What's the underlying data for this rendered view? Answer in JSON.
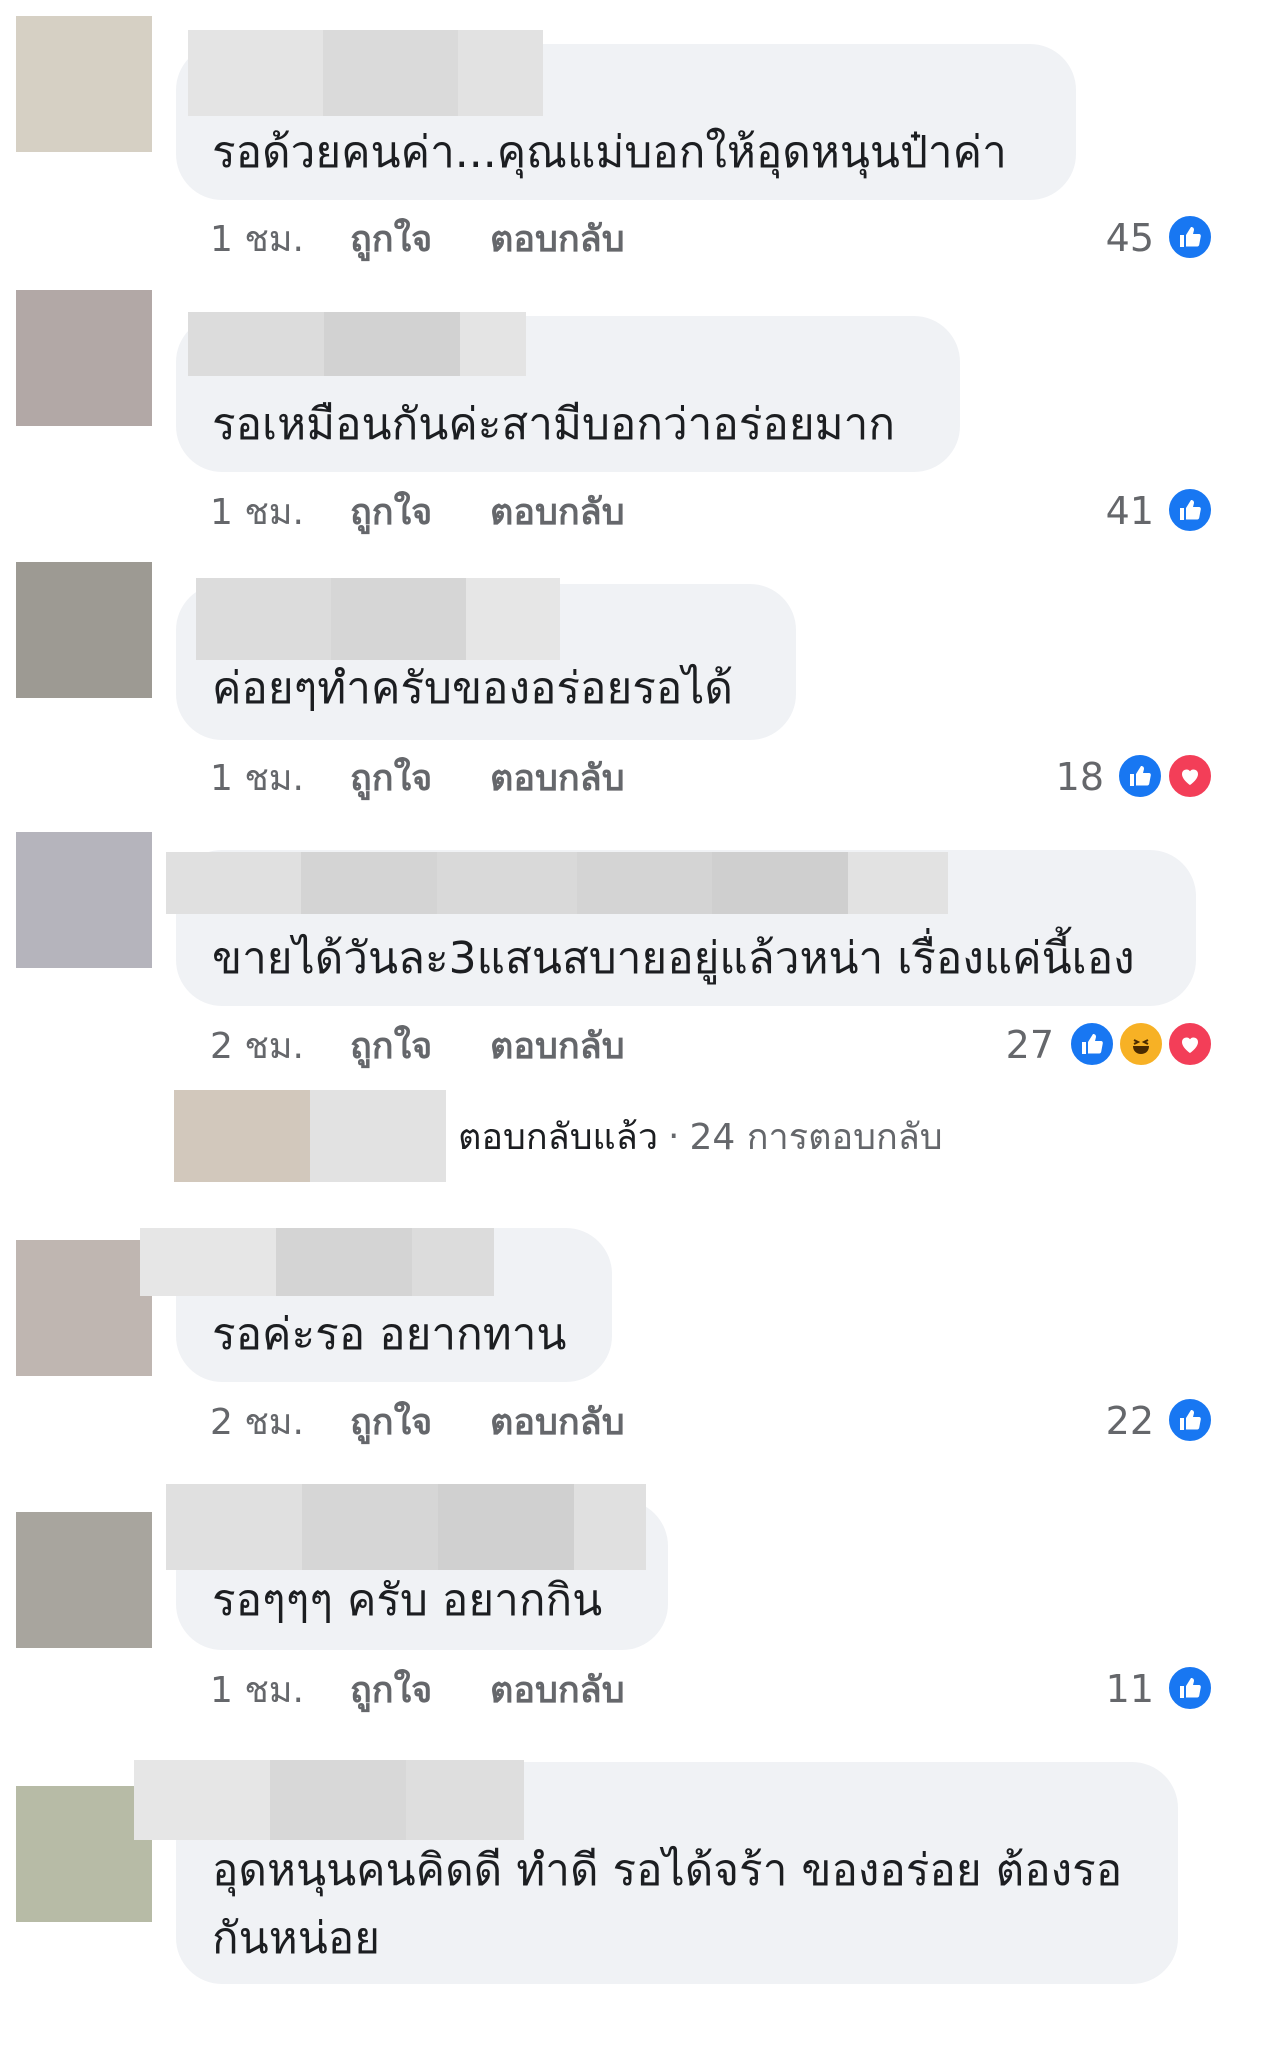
{
  "comments": [
    {
      "text": "รอด้วยคนค่า...คุณแม่บอกให้อุดหนุนป๋าค่า",
      "time": "1 ชม.",
      "like": "ถูกใจ",
      "reply": "ตอบกลับ",
      "count": "45",
      "reactions": [
        "like"
      ]
    },
    {
      "text": "รอเหมือนกันค่ะสามีบอกว่าอร่อยมาก",
      "time": "1 ชม.",
      "like": "ถูกใจ",
      "reply": "ตอบกลับ",
      "count": "41",
      "reactions": [
        "like"
      ]
    },
    {
      "text": "ค่อยๆทำครับของอร่อยรอได้",
      "time": "1 ชม.",
      "like": "ถูกใจ",
      "reply": "ตอบกลับ",
      "count": "18",
      "reactions": [
        "like",
        "love"
      ]
    },
    {
      "text": "ขายได้วันละ3แสนสบายอยู่แล้วหน่า เรื่องแค่นี้เอง",
      "time": "2 ชม.",
      "like": "ถูกใจ",
      "reply": "ตอบกลับ",
      "count": "27",
      "reactions": [
        "like",
        "haha",
        "love"
      ]
    },
    {
      "text": "รอค่ะรอ อยากทาน",
      "time": "2 ชม.",
      "like": "ถูกใจ",
      "reply": "ตอบกลับ",
      "count": "22",
      "reactions": [
        "like"
      ]
    },
    {
      "text": "รอๆๆๆ ครับ อยากกิน",
      "time": "1 ชม.",
      "like": "ถูกใจ",
      "reply": "ตอบกลับ",
      "count": "11",
      "reactions": [
        "like"
      ]
    },
    {
      "text_line1": "อุดหนุนคนคิดดี ทำดี รอได้จร้า ของอร่อย ต้องรอ",
      "text_line2": "กันหน่อย"
    }
  ],
  "replies_summary": {
    "label": "ตอบกลับแล้ว",
    "separator": "·",
    "count": "24 การตอบกลับ"
  },
  "colors": {
    "bubble": "#f0f2f5",
    "like": "#1877f2",
    "love": "#f33e58",
    "haha": "#f7b125",
    "meta": "#65676b"
  }
}
